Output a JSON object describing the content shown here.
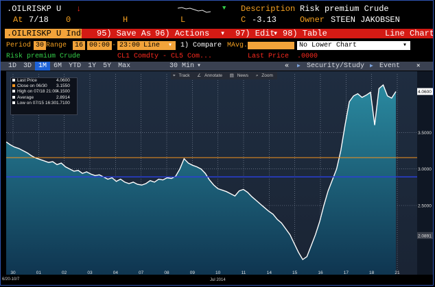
{
  "header": {
    "ticker": ".OILRISKP U",
    "arrow": "↓",
    "description_label": "Description",
    "description_value": "Risk premium Crude",
    "at_label": "At",
    "at_date": "7/18",
    "o_label": "0",
    "h_label": "H",
    "l_label": "L",
    "c_label": "C",
    "c_value": "-3.13",
    "owner_label": "Owner",
    "owner_value": "STEEN JAKOBSEN"
  },
  "menu": {
    "index_label": ".OILRISKP U Index",
    "save_as": "95) Save As",
    "actions": "96) Actions",
    "edit": "97) Edit",
    "table": "98) Table",
    "line_chart": "Line Chart",
    "dropdown_arrow": "▾"
  },
  "controls": {
    "period_label": "Period",
    "period_value": "30",
    "range_label": "Range",
    "range_value": "16",
    "time_start": "00:00",
    "time_sep": "-",
    "time_end": "23:00",
    "type_value": "Line",
    "compare_label": "1) Compare",
    "mavg_label": "MAvg.",
    "lower_chart_value": "No Lower Chart"
  },
  "status": {
    "name": "Risk premium Crude",
    "formula": "CL1 Comdty - CL5 Com...",
    "last_price_label": "Last Price",
    "last_price_value": ".0000"
  },
  "tabs": {
    "items": [
      "1D",
      "3D",
      "1M",
      "6M",
      "YTD",
      "1Y",
      "5Y",
      "Max"
    ],
    "active": "1M",
    "interval": "30 Min",
    "collapse": "«",
    "security_study": "Security/Study",
    "event": "Event",
    "sec_icon": "▶",
    "event_icon": "▶"
  },
  "chart_toolbar": {
    "track": "Track",
    "annotate": "Annotate",
    "news": "News",
    "zoom": "Zoom"
  },
  "legend": [
    {
      "label": "Last Price",
      "value": "4.0600"
    },
    {
      "label": "Close on 06/30",
      "value": "3.1550"
    },
    {
      "label": "High on 07/18 21:00",
      "value": "4.1500"
    },
    {
      "label": "Average",
      "value": "2.8914"
    },
    {
      "label": "Low on 07/15 16:30",
      "value": "1.7100"
    }
  ],
  "colors": {
    "area_line": "#ffffff",
    "average_line": "#2a3fd8",
    "close_line": "#f7941d",
    "bg_top": "#1f2d40",
    "bg_bottom": "#1e6d86"
  },
  "chart_data": {
    "type": "area",
    "ylim": [
      1.6,
      4.3
    ],
    "yticks": [
      "4.0600",
      "3.5000",
      "3.0000",
      "2.5000",
      "2.0891"
    ],
    "x_labels": [
      "30",
      "01",
      "02",
      "03",
      "04",
      "07",
      "08",
      "09",
      "10",
      "11",
      "14",
      "15",
      "16",
      "17",
      "18",
      "21"
    ],
    "bottom_left_label": "6/20-10/7",
    "month_label": "Jul 2014",
    "average": 2.8914,
    "close_ref": 3.155,
    "series": [
      {
        "values": [
          3.37,
          3.33,
          3.3,
          3.28,
          3.25,
          3.22,
          3.18,
          3.15,
          3.13,
          3.11,
          3.09,
          3.1,
          3.06,
          3.08,
          3.03,
          3.0,
          2.97,
          2.98,
          2.94,
          2.96,
          2.93,
          2.91,
          2.92,
          2.89,
          2.86,
          2.88,
          2.83,
          2.86,
          2.82,
          2.8,
          2.82,
          2.79,
          2.78,
          2.8,
          2.84,
          2.82,
          2.86,
          2.85,
          2.88,
          2.87,
          2.9,
          3.0,
          3.14,
          3.08,
          3.05,
          3.03,
          3.0,
          2.94,
          2.85,
          2.78,
          2.73,
          2.71,
          2.69,
          2.66,
          2.63,
          2.7,
          2.72,
          2.68,
          2.62,
          2.57,
          2.52,
          2.47,
          2.42,
          2.38,
          2.31,
          2.26,
          2.18,
          2.1,
          1.98,
          1.86,
          1.76,
          1.8,
          1.95,
          2.1,
          2.28,
          2.5,
          2.7,
          2.85,
          3.0,
          3.25,
          3.6,
          3.92,
          4.0,
          4.03,
          3.98,
          4.01,
          4.05,
          3.6,
          4.1,
          4.15,
          4.0,
          3.97,
          4.06
        ]
      }
    ]
  }
}
